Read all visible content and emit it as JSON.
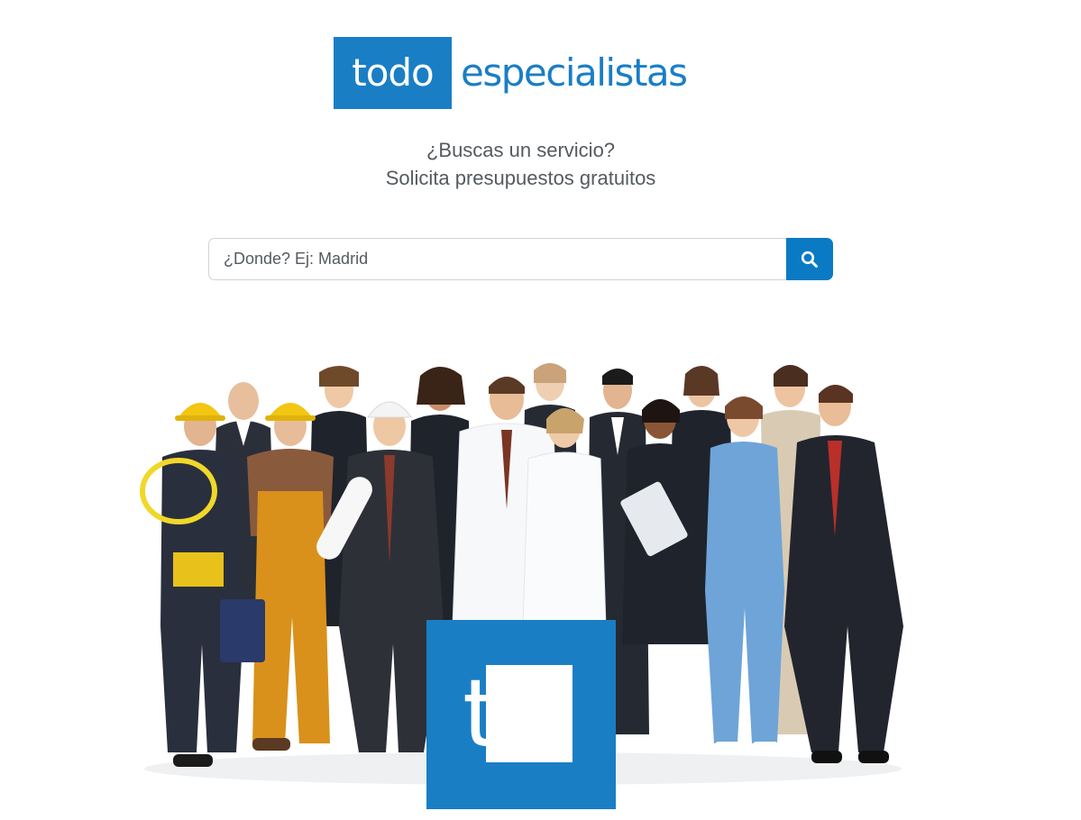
{
  "brand": {
    "logo_left": "todo",
    "logo_right": "especialistas",
    "accent_color": "#1a7ec5"
  },
  "tagline": {
    "line1": "¿Buscas un servicio?",
    "line2": "Solicita presupuestos gratuitos"
  },
  "search": {
    "placeholder": "¿Donde? Ej: Madrid",
    "value": "",
    "button_icon": "search-icon"
  },
  "hero": {
    "image": "group-of-professionals-photo",
    "mark_text": "te"
  }
}
